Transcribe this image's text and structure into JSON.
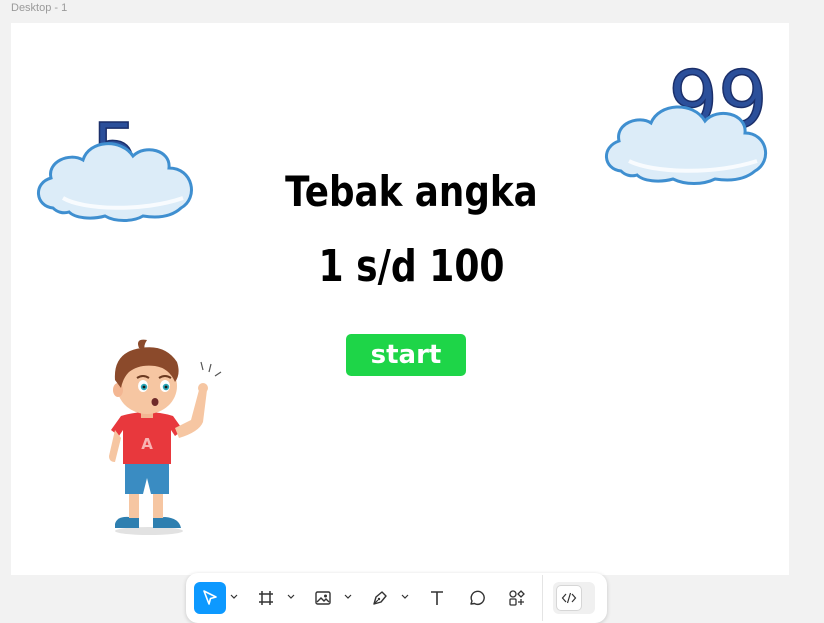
{
  "canvas": {
    "frame_label": "Desktop - 1"
  },
  "artboard": {
    "title": "Tebak angka",
    "subtitle": "1 s/d 100",
    "start_label": "start",
    "number_left": "5",
    "number_right": "99"
  },
  "colors": {
    "start_button": "#1ed548",
    "number_blue": "#2b4f9a",
    "cloud_fill": "#dcecf8",
    "cloud_outline": "#3f8fd0",
    "toolbar_active": "#0d99ff"
  },
  "toolbar": {
    "tools": [
      {
        "name": "move-tool",
        "icon": "cursor-arrow-icon",
        "active": true,
        "has_menu": true
      },
      {
        "name": "frame-tool",
        "icon": "frame-hash-icon",
        "active": false,
        "has_menu": true
      },
      {
        "name": "image-tool",
        "icon": "image-icon",
        "active": false,
        "has_menu": true
      },
      {
        "name": "pen-tool",
        "icon": "pen-nib-icon",
        "active": false,
        "has_menu": true
      },
      {
        "name": "text-tool",
        "icon": "text-t-icon",
        "active": false,
        "has_menu": false
      },
      {
        "name": "comment-tool",
        "icon": "speech-bubble-icon",
        "active": false,
        "has_menu": false
      },
      {
        "name": "actions-tool",
        "icon": "shapes-plus-icon",
        "active": false,
        "has_menu": false
      },
      {
        "name": "dev-mode-toggle",
        "icon": "code-brackets-icon",
        "active": false,
        "has_menu": false
      }
    ]
  }
}
